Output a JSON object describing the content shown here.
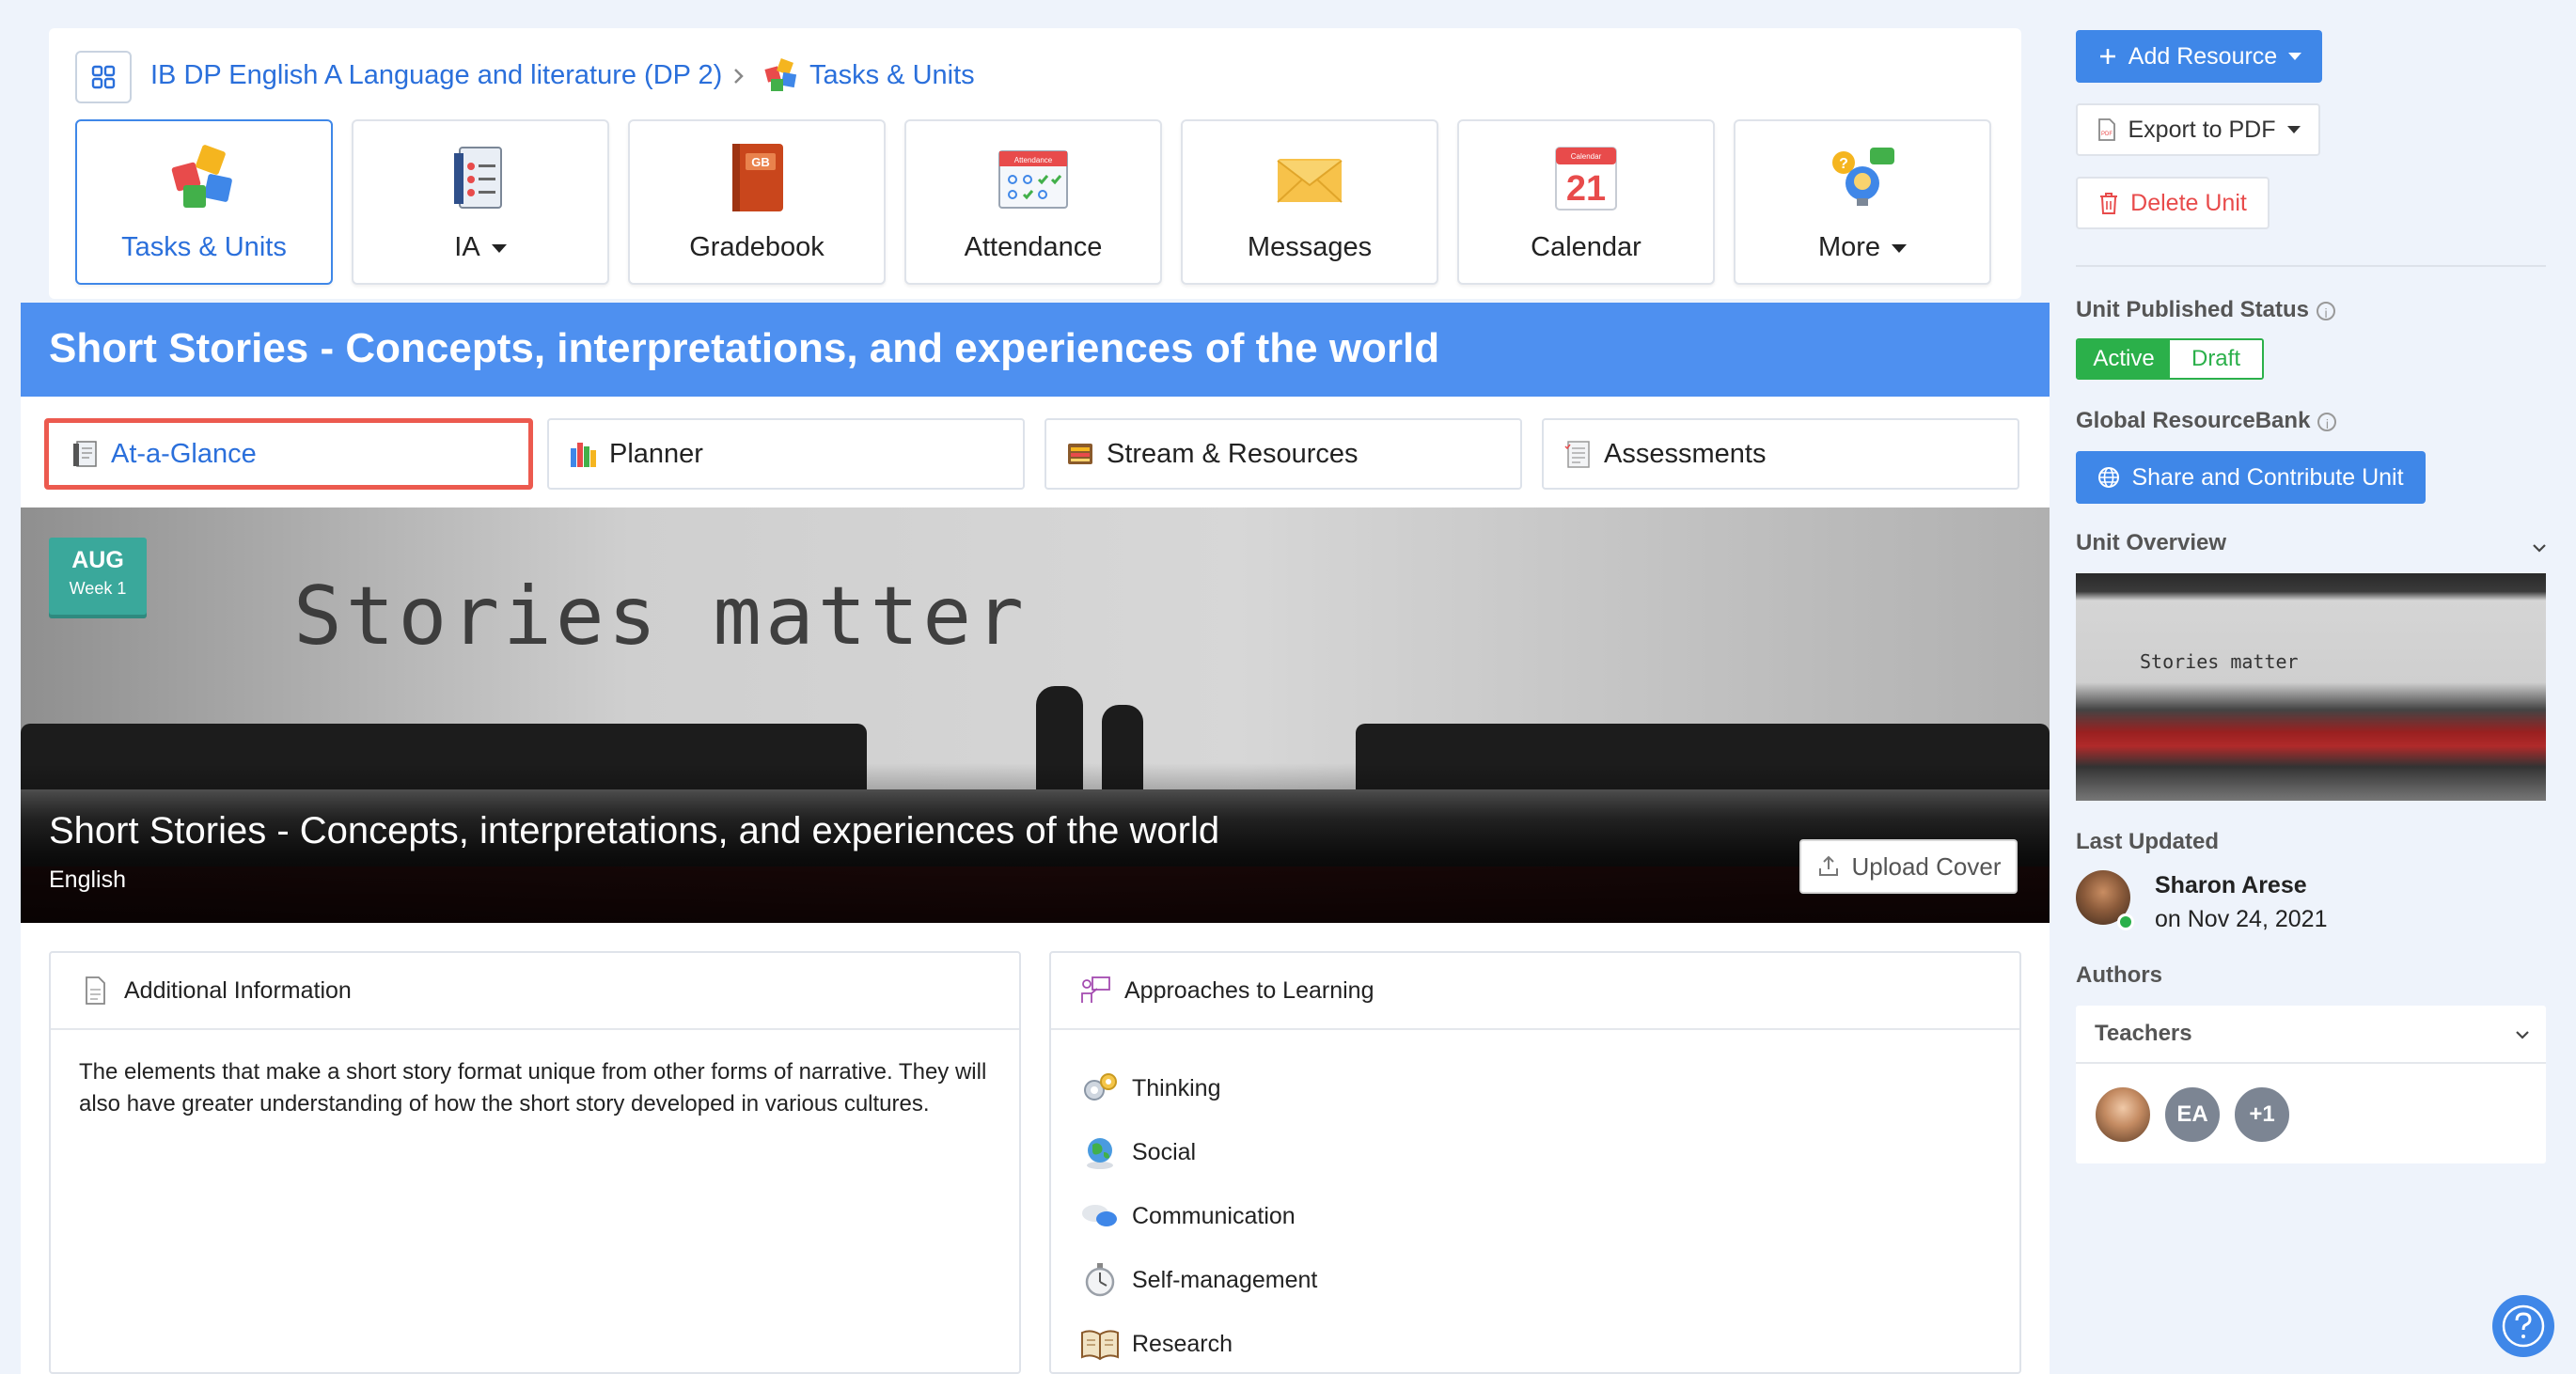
{
  "breadcrumb": {
    "course": "IB DP English A Language and literature (DP 2)",
    "section": "Tasks & Units"
  },
  "nav": {
    "tiles": [
      {
        "label": "Tasks & Units",
        "icon": "puzzle-icon"
      },
      {
        "label": "IA",
        "icon": "clipboard-icon"
      },
      {
        "label": "Gradebook",
        "icon": "gradebook-icon"
      },
      {
        "label": "Attendance",
        "icon": "attendance-calendar-icon"
      },
      {
        "label": "Messages",
        "icon": "envelope-icon"
      },
      {
        "label": "Calendar",
        "icon": "calendar-icon"
      },
      {
        "label": "More",
        "icon": "lightbulb-chat-icon"
      }
    ],
    "gradebook_badge": "GB",
    "attendance_badge": "Attendance",
    "calendar_badge": "Calendar",
    "calendar_day": "21"
  },
  "unit": {
    "title": "Short Stories - Concepts, interpretations, and experiences of the world",
    "subject": "English",
    "cover_text": "Stories matter",
    "date_month": "AUG",
    "date_week": "Week 1",
    "upload_cover_label": "Upload Cover"
  },
  "tabs": [
    {
      "label": "At-a-Glance",
      "icon": "notebook-icon"
    },
    {
      "label": "Planner",
      "icon": "books-icon"
    },
    {
      "label": "Stream & Resources",
      "icon": "stream-icon"
    },
    {
      "label": "Assessments",
      "icon": "checklist-icon"
    }
  ],
  "additional_info": {
    "heading": "Additional Information",
    "text": "The elements that make a short story format unique from other forms of narrative. They will also have greater understanding of how the short story developed in various cultures."
  },
  "approaches": {
    "heading": "Approaches to Learning",
    "items": [
      {
        "label": "Thinking",
        "icon": "gears-icon"
      },
      {
        "label": "Social",
        "icon": "globe-icon"
      },
      {
        "label": "Communication",
        "icon": "speech-bubbles-icon"
      },
      {
        "label": "Self-management",
        "icon": "stopwatch-icon"
      },
      {
        "label": "Research",
        "icon": "open-book-icon"
      }
    ]
  },
  "sidebar": {
    "add_resource": "Add Resource",
    "export_pdf": "Export to PDF",
    "delete_unit": "Delete Unit",
    "published_status_label": "Unit Published Status",
    "status_active": "Active",
    "status_draft": "Draft",
    "resourcebank_label": "Global ResourceBank",
    "share_button": "Share and Contribute Unit",
    "overview_label": "Unit Overview",
    "overview_text": "Stories matter",
    "last_updated_label": "Last Updated",
    "updated_by": "Sharon Arese",
    "updated_on": "on Nov 24, 2021",
    "authors_label": "Authors",
    "teachers_label": "Teachers",
    "author_chips": [
      "EA",
      "+1"
    ]
  },
  "colors": {
    "accent": "#3f87e8",
    "banner": "#4e90f0",
    "active_green": "#2bb04a",
    "danger": "#e84b4b",
    "badge_teal": "#3aa89b",
    "tab_highlight": "#ec5a4f"
  }
}
